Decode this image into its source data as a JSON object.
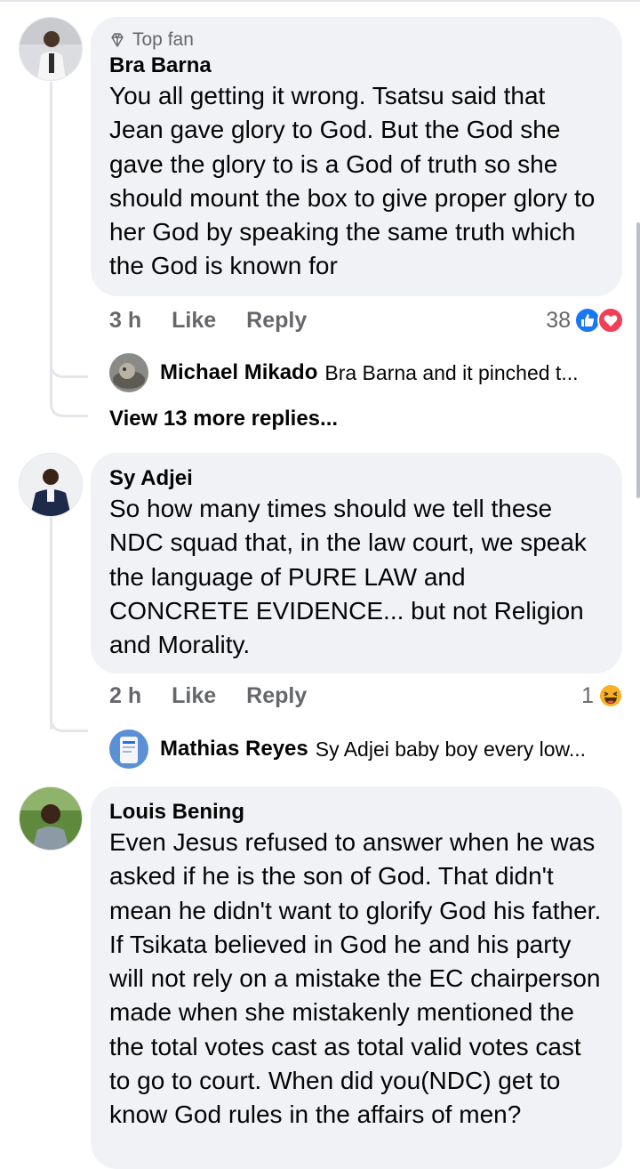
{
  "comments": [
    {
      "badge": "Top fan",
      "author": "Bra Barna",
      "text": "You all getting it wrong. Tsatsu said that Jean gave glory to God. But the God she gave the glory to is a God of truth so she should mount the box to give proper glory to her God by speaking the same truth which the God is known for",
      "time": "3 h",
      "like_label": "Like",
      "reply_label": "Reply",
      "reaction_count": "38",
      "reactions": [
        "like-icon",
        "love-icon"
      ],
      "reply_preview": {
        "author": "Michael Mikado",
        "text": "Bra Barna and it pinched t..."
      },
      "view_more": "View 13 more replies..."
    },
    {
      "author": "Sy Adjei",
      "text": "So how many times should we tell these NDC squad that, in the law court, we speak the language of PURE LAW and CONCRETE EVIDENCE... but not Religion and Morality.",
      "time": "2 h",
      "like_label": "Like",
      "reply_label": "Reply",
      "reaction_count": "1",
      "reactions": [
        "haha-icon"
      ],
      "reply_preview": {
        "author": "Mathias Reyes",
        "text": "Sy Adjei baby boy every low..."
      }
    },
    {
      "author": "Louis Bening",
      "text": "Even Jesus refused to answer when he was asked if he is the son of God. That didn't mean he didn't want to glorify God his father. If Tsikata believed in God he and his party will not rely on a mistake the EC chairperson made when she mistakenly mentioned the the total votes cast as total valid votes cast to go to court. When did you(NDC) get to know God rules in the affairs of men?"
    }
  ],
  "colors": {
    "bubble": "#f0f2f5",
    "meta": "#65676b",
    "like_blue": "#1877f2",
    "love_red": "#f33e58",
    "haha_yellow": "#f7b125"
  }
}
